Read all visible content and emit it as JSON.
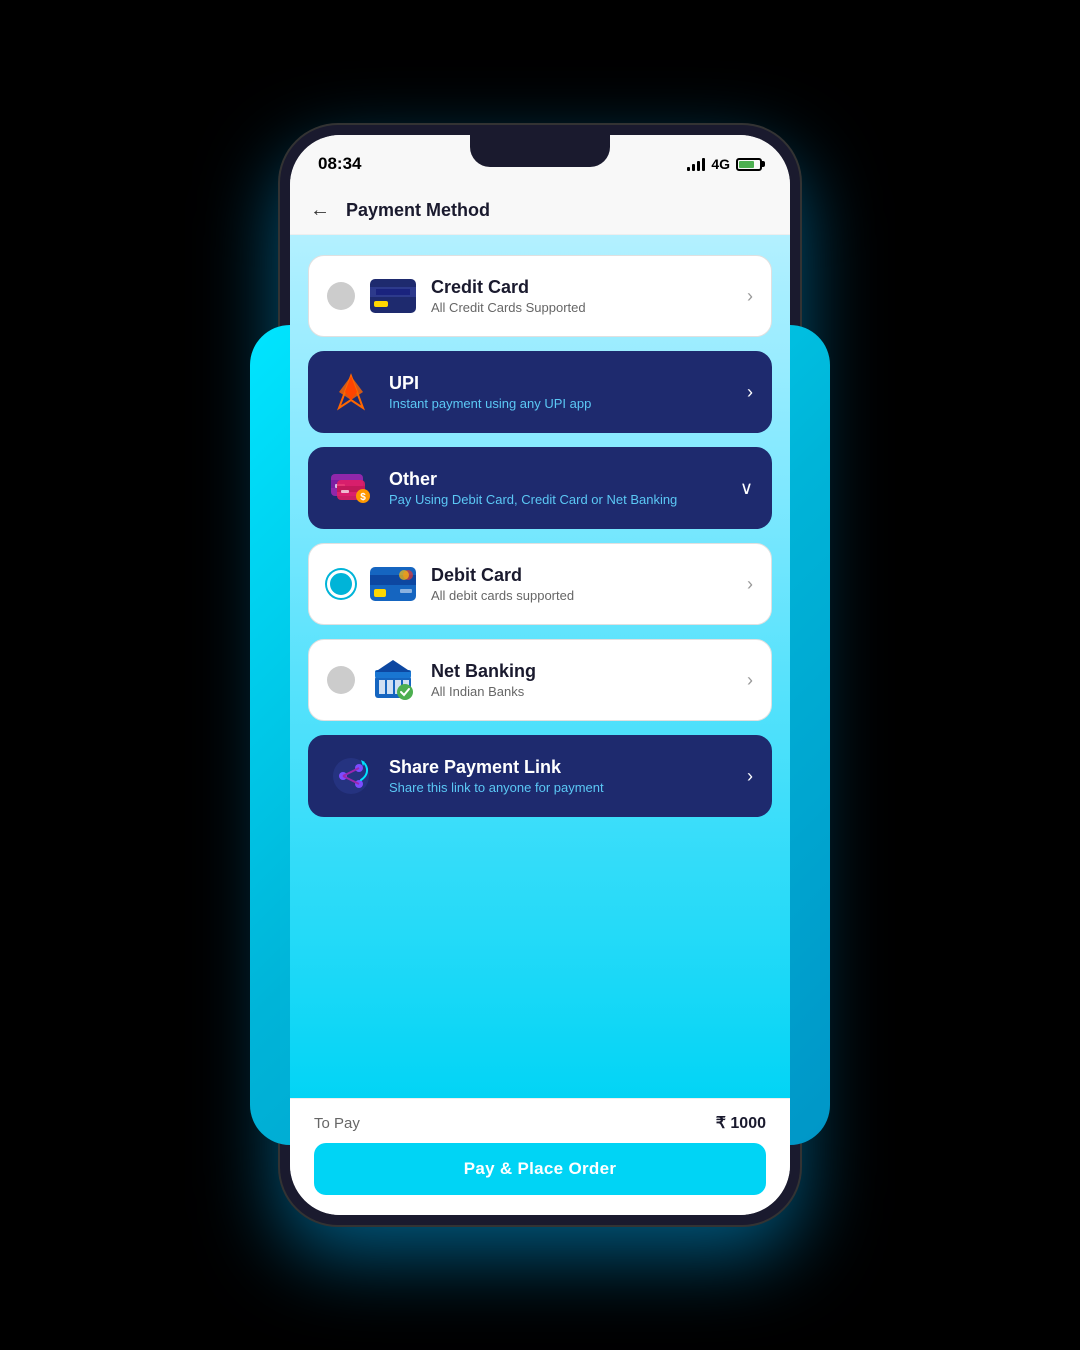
{
  "statusBar": {
    "time": "08:34",
    "network": "4G"
  },
  "header": {
    "backLabel": "←",
    "title": "Payment Method"
  },
  "paymentMethods": [
    {
      "id": "credit-card",
      "title": "Credit Card",
      "subtitle": "All Credit Cards Supported",
      "dark": false,
      "radio": "inactive",
      "chevron": "›",
      "iconType": "credit-card"
    },
    {
      "id": "upi",
      "title": "UPI",
      "subtitle": "Instant payment using any UPI app",
      "dark": true,
      "radio": "none",
      "chevron": "›",
      "iconType": "upi"
    },
    {
      "id": "other",
      "title": "Other",
      "subtitle": "Pay Using Debit Card, Credit Card or Net Banking",
      "dark": true,
      "radio": "none",
      "chevron": "∨",
      "iconType": "other"
    },
    {
      "id": "debit-card",
      "title": "Debit Card",
      "subtitle": "All debit cards supported",
      "dark": false,
      "radio": "active",
      "chevron": "›",
      "iconType": "debit-card"
    },
    {
      "id": "net-banking",
      "title": "Net Banking",
      "subtitle": "All Indian Banks",
      "dark": false,
      "radio": "inactive",
      "chevron": "›",
      "iconType": "net-banking"
    },
    {
      "id": "share-payment",
      "title": "Share Payment Link",
      "subtitle": "Share this link to anyone for payment",
      "dark": true,
      "radio": "none",
      "chevron": "›",
      "iconType": "share"
    }
  ],
  "footer": {
    "toPayLabel": "To Pay",
    "amount": "₹ 1000",
    "buttonLabel": "Pay & Place Order"
  }
}
